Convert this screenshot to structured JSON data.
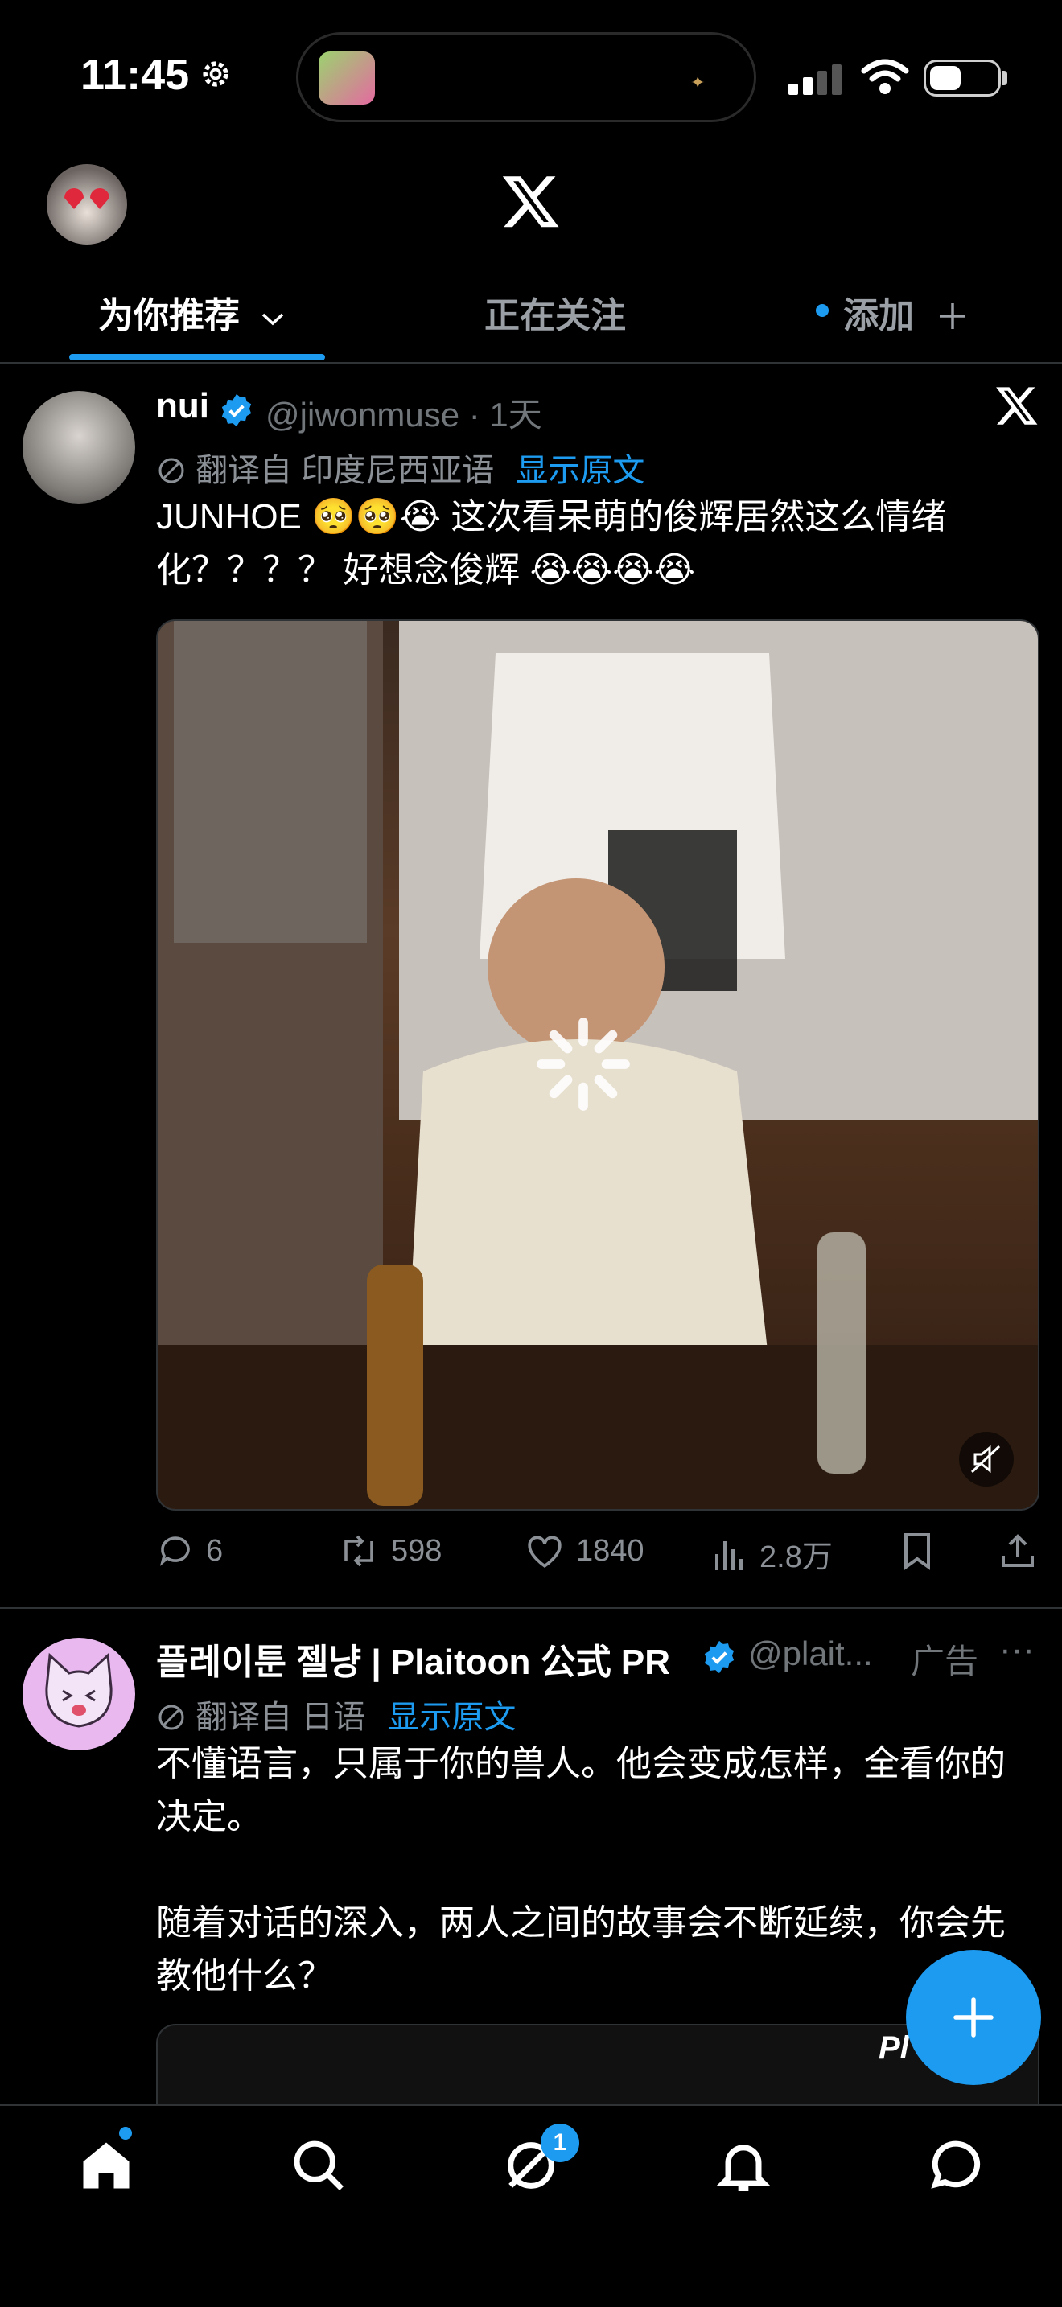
{
  "status": {
    "time": "11:45"
  },
  "header": {
    "tabs": [
      {
        "label": "为你推荐"
      },
      {
        "label": "正在关注"
      },
      {
        "label": "添加"
      }
    ]
  },
  "tweets": [
    {
      "name": "nui",
      "handle": "@jiwonmuse · 1天",
      "translated_from": "翻译自 印度尼西亚语",
      "show_original": "显示原文",
      "text": "JUNHOE 🥺🥺😭 这次看呆萌的俊辉居然这么情绪化？？？？ 好想念俊辉 😭😭😭😭",
      "stats": {
        "replies": "6",
        "reposts": "598",
        "likes": "1840",
        "views": "2.8万"
      }
    },
    {
      "name": "플레이툰 젤냥 | Plaitoon 公式 PR",
      "handle": "@plait...",
      "ad_label": "广告",
      "more": "···",
      "translated_from": "翻译自 日语",
      "show_original": "显示原文",
      "text": "不懂语言，只属于你的兽人。他会变成怎样，全看你的决定。\n\n随着对话的深入，两人之间的故事会不断延续，你会先教他什么？",
      "media_brand": "Pl"
    }
  ],
  "bottom_nav": {
    "messages_badge": "1"
  },
  "colors": {
    "accent": "#1d9bf0",
    "background": "#000000",
    "muted": "#71767b"
  }
}
